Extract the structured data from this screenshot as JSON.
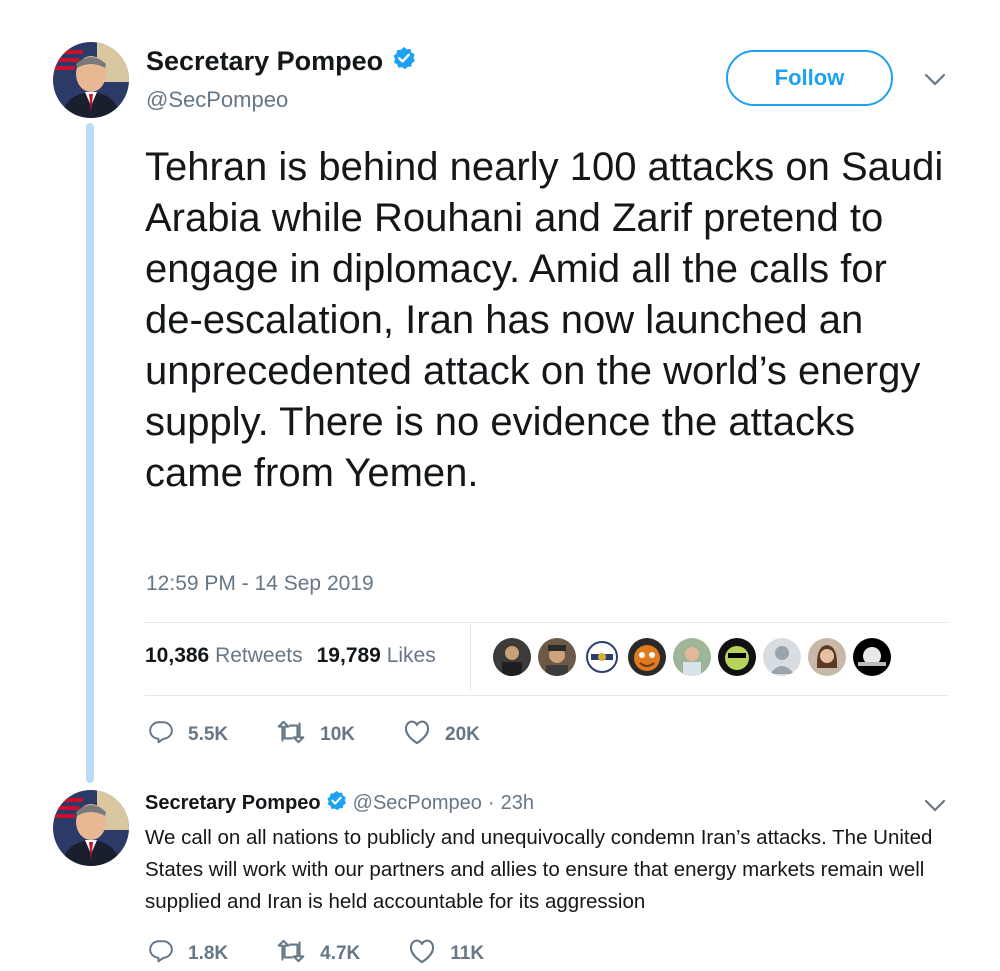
{
  "tweet": {
    "author_name": "Secretary Pompeo",
    "author_handle": "@SecPompeo",
    "follow_label": "Follow",
    "text": "Tehran is behind nearly 100 attacks on Saudi Arabia while Rouhani and Zarif pretend to engage in diplomacy. Amid all the calls for de-escalation, Iran has now launched an unprecedented attack on the world’s energy supply.  There is no evidence the attacks came from Yemen.",
    "timestamp": "12:59 PM - 14 Sep 2019",
    "retweets_count": "10,386",
    "retweets_label": "Retweets",
    "likes_count": "19,789",
    "likes_label": "Likes",
    "actions": {
      "replies": "5.5K",
      "retweets": "10K",
      "likes": "20K"
    }
  },
  "reply": {
    "author_name": "Secretary Pompeo",
    "author_handle": "@SecPompeo",
    "separator": "·",
    "time": "23h",
    "text": "We call on all nations to publicly and unequivocally condemn Iran’s attacks. The United States will work with our partners and allies to ensure that energy markets remain well supplied and Iran is held accountable for its aggression",
    "actions": {
      "replies": "1.8K",
      "retweets": "4.7K",
      "likes": "11K"
    }
  },
  "colors": {
    "accent": "#1da1f2",
    "thread_line": "#b8dcf5",
    "secondary_text": "#657786",
    "divider": "#e1e8ed"
  }
}
